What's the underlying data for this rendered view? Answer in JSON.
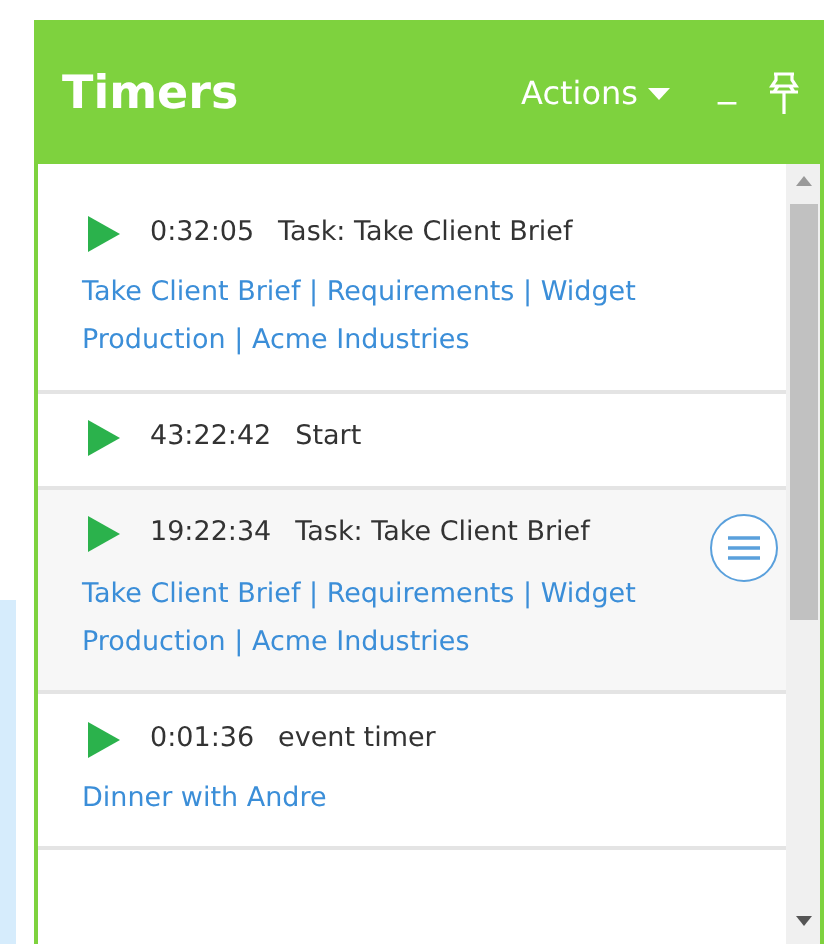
{
  "panel": {
    "title": "Timers",
    "actions_label": "Actions",
    "minimize_label": "_"
  },
  "timers": [
    {
      "elapsed": "0:32:05",
      "description": "Task: Take Client Brief",
      "path": "Take Client Brief | Requirements | Widget Production | Acme Industries",
      "highlighted": false
    },
    {
      "elapsed": "43:22:42",
      "description": "Start",
      "highlighted": false
    },
    {
      "elapsed": "19:22:34",
      "description": "Task: Take Client Brief",
      "path": "Take Client Brief | Requirements | Widget Production | Acme Industries",
      "highlighted": true
    },
    {
      "elapsed": "0:01:36",
      "description": "event timer",
      "path": "Dinner with Andre",
      "highlighted": false
    }
  ]
}
